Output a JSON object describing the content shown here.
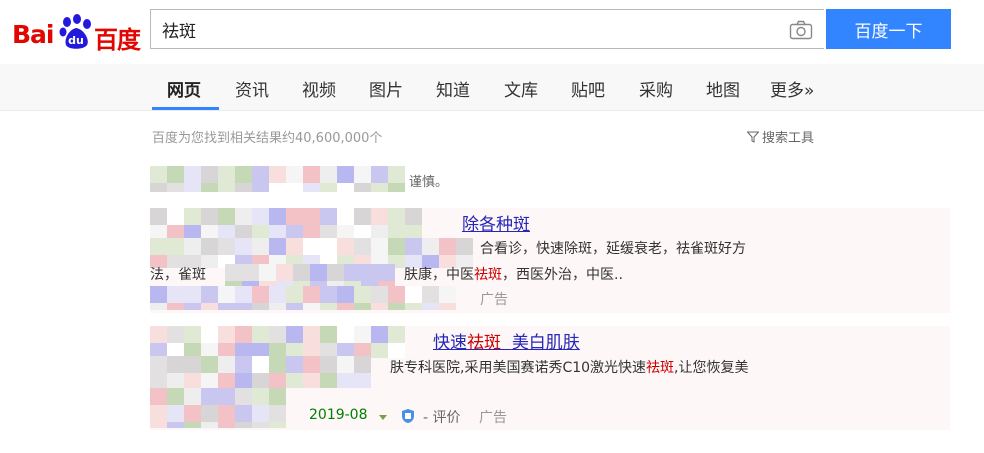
{
  "header": {
    "logo": {
      "bai": "Bai",
      "du": "du",
      "cn": "百度"
    },
    "search_value": "祛斑",
    "search_button": "百度一下",
    "icons": {
      "camera": "camera-icon"
    }
  },
  "tabs": [
    {
      "label": "网页",
      "active": true
    },
    {
      "label": "资讯",
      "active": false
    },
    {
      "label": "视频",
      "active": false
    },
    {
      "label": "图片",
      "active": false
    },
    {
      "label": "知道",
      "active": false
    },
    {
      "label": "文库",
      "active": false
    },
    {
      "label": "贴吧",
      "active": false
    },
    {
      "label": "采购",
      "active": false
    },
    {
      "label": "地图",
      "active": false
    },
    {
      "label": "更多»",
      "active": false
    }
  ],
  "meta": {
    "result_count": "百度为您找到相关结果约40,600,000个",
    "tools_label": "搜索工具",
    "notice_tail": "谨慎。"
  },
  "ads": [
    {
      "title_tail": "除各种斑",
      "desc_line1_tail": "合看诊，快速除斑，延缓衰老，祛雀斑好方",
      "desc_line2_a": "法，雀斑",
      "desc_line2_b": "肤康，中医",
      "desc_line2_hl": "祛斑",
      "desc_line2_c": "，西医外治，中医..",
      "tag": "广告"
    },
    {
      "title_a": "快速",
      "title_hl": "祛斑",
      "title_b": "美白肌肤",
      "desc_a": "肤专科医院,采用美国赛诺秀C10激光快速",
      "desc_hl": "祛斑",
      "desc_b": ",让您恢复美",
      "date": "2019-08",
      "eval": "- 评价",
      "tag": "广告"
    }
  ],
  "colors": {
    "brand_red": "#e10601",
    "brand_blue": "#3385ff",
    "link_blue": "#2626b8",
    "highlight_red": "#cc0000",
    "url_green": "#008000"
  }
}
